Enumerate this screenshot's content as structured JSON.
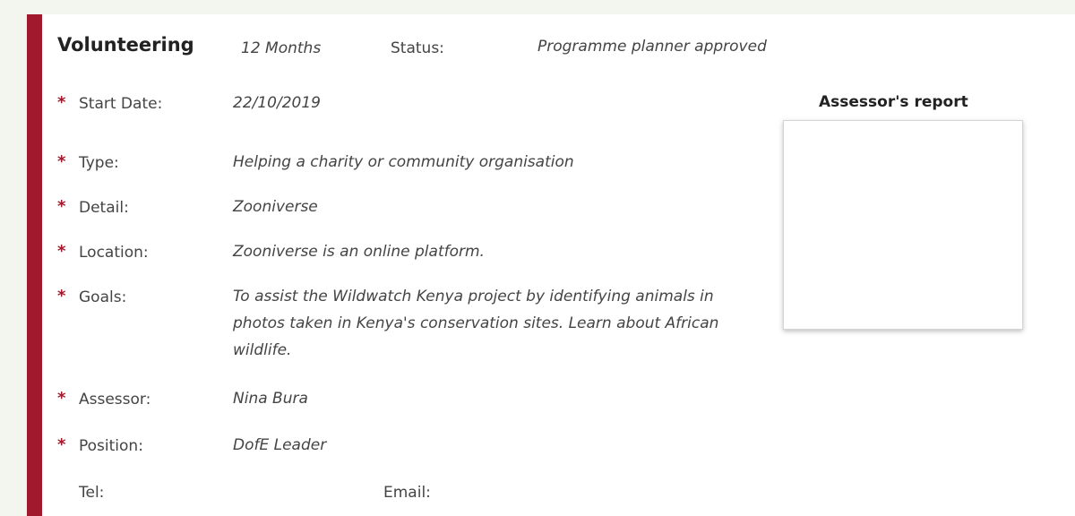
{
  "activity": {
    "section_title": "Volunteering",
    "duration": "12 Months",
    "status_label": "Status:",
    "status_value": "Programme planner approved"
  },
  "fields": {
    "start_date": {
      "label": "Start Date:",
      "value": "22/10/2019"
    },
    "type": {
      "label": "Type:",
      "value": "Helping a charity or community organisation"
    },
    "detail": {
      "label": "Detail:",
      "value": "Zooniverse"
    },
    "location": {
      "label": "Location:",
      "value": "Zooniverse is an online platform."
    },
    "goals": {
      "label": "Goals:",
      "value": "To assist the Wildwatch Kenya project by identifying animals in photos taken in Kenya's conservation sites. Learn about African wildlife."
    },
    "assessor": {
      "label": "Assessor:",
      "value": "Nina Bura"
    },
    "position": {
      "label": "Position:",
      "value": "DofE Leader"
    }
  },
  "required_marker": "*",
  "contact": {
    "tel_label": "Tel:",
    "email_label": "Email:"
  },
  "report": {
    "title": "Assessor's report"
  },
  "colors": {
    "accent": "#a1192c",
    "background": "#f2f6ee",
    "panel": "#ffffff"
  }
}
